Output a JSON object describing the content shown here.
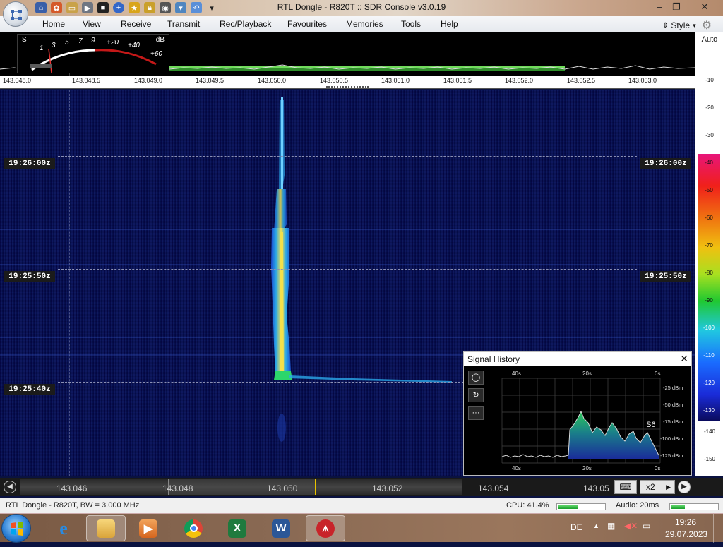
{
  "titlebar": {
    "title": "RTL Dongle - R820T :: SDR Console v3.0.19",
    "minimize": "–",
    "maximize": "❐",
    "close": "✕"
  },
  "menu": {
    "items": [
      "Home",
      "View",
      "Receive",
      "Transmit",
      "Rec/Playback",
      "Favourites",
      "Memories",
      "Tools",
      "Help"
    ],
    "style_label": "Style"
  },
  "smeter": {
    "s_label": "S",
    "db_label": "dB",
    "s_scale": [
      "1",
      "3",
      "5",
      "7",
      "9"
    ],
    "db_scale": [
      "+20",
      "+40",
      "+60"
    ]
  },
  "frequency_axis": {
    "labels": [
      "143.048.0",
      "143.048.5",
      "143.049.0",
      "143.049.5",
      "143.050.0",
      "143.050.5",
      "143.051.0",
      "143.051.5",
      "143.052.0",
      "143.052.5",
      "143.053.0"
    ]
  },
  "waterfall": {
    "timestamps": [
      "19:26:00z",
      "19:25:50z",
      "19:25:40z"
    ]
  },
  "db_scale": {
    "auto_label": "Auto",
    "ticks": [
      "-10",
      "-20",
      "-30",
      "-40",
      "-50",
      "-60",
      "-70",
      "-80",
      "-90",
      "-100",
      "-110",
      "-120",
      "-130",
      "-140",
      "-150"
    ]
  },
  "signal_history": {
    "title": "Signal History",
    "close": "✕",
    "time_labels": [
      "40s",
      "20s",
      "0s"
    ],
    "dbm_labels": [
      "-25 dBm",
      "-50 dBm",
      "-75 dBm",
      "-100 dBm",
      "-125 dBm"
    ],
    "s_reading": "S6",
    "buttons": [
      "◯",
      "↻",
      "···"
    ]
  },
  "tuning_bar": {
    "labels": [
      "143.046",
      "143.048",
      "143.050",
      "143.052",
      "143.054",
      "143.05"
    ],
    "zoom_label": "x2",
    "prev": "◀",
    "next": "▶"
  },
  "statusbar": {
    "device": "RTL Dongle - R820T, BW = 3.000 MHz",
    "cpu": "CPU: 41.4%",
    "cpu_level": 0.41,
    "audio": "Audio: 20ms",
    "audio_level": 0.3
  },
  "taskbar": {
    "apps": [
      "Internet Explorer",
      "Windows Explorer",
      "Windows Media Player",
      "Google Chrome",
      "Microsoft Excel",
      "Microsoft Word",
      "SDR Console"
    ],
    "language": "DE",
    "time": "19:26",
    "date": "29.07.2023"
  },
  "colors": {
    "waterfall_bg": "#0c1553",
    "tuning_marker": "#e8c300",
    "signal_core": "#f4e04a"
  }
}
